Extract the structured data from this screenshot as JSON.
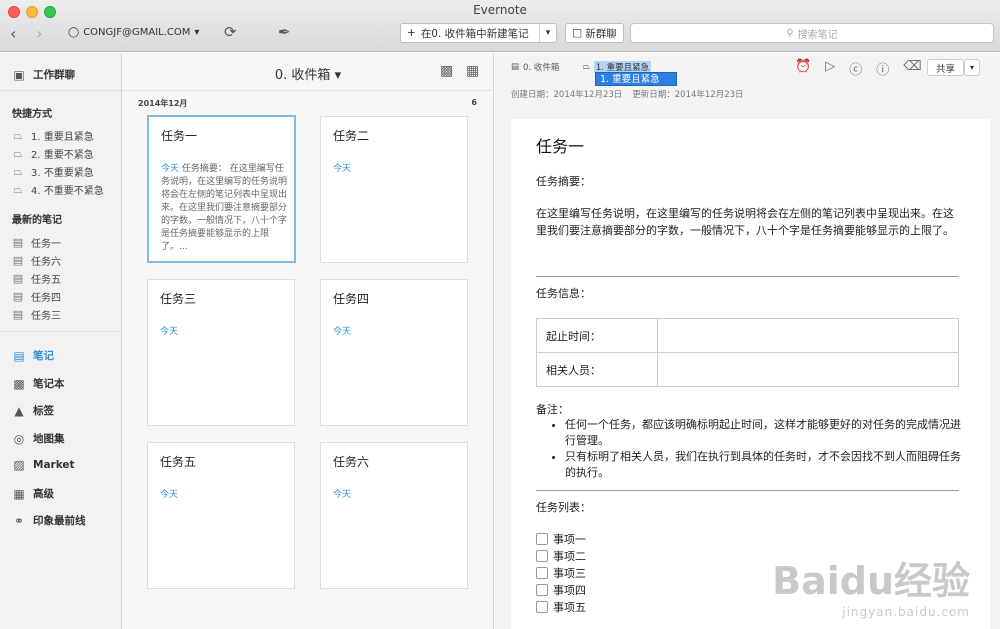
{
  "window": {
    "title": "Evernote"
  },
  "toolbar": {
    "account": "CONGJF@GMAIL.COM",
    "new_note_label": "在0. 收件箱中新建笔记",
    "chat_label": "新群聊",
    "search_placeholder": "搜索笔记"
  },
  "sidebar": {
    "work_chat": "工作群聊",
    "shortcuts_heading": "快捷方式",
    "shortcuts": [
      "1. 重要且紧急",
      "2. 重要不紧急",
      "3. 不重要紧急",
      "4. 不重要不紧急"
    ],
    "recent_heading": "最新的笔记",
    "recent": [
      "任务一",
      "任务六",
      "任务五",
      "任务四",
      "任务三"
    ],
    "nav": [
      "笔记",
      "笔记本",
      "标签",
      "地图集",
      "Market",
      "高级",
      "印象最前线"
    ]
  },
  "notelist": {
    "title": "0. 收件箱",
    "date_group": "2014年12月",
    "count": "6",
    "cards": [
      {
        "title": "任务一",
        "date": "今天",
        "snippet": "任务摘要： 在这里编写任务说明，在这里编写的任务说明将会在左侧的笔记列表中呈现出来。在这里我们要注意摘要部分的字数，一般情况下，八十个字是任务摘要能够显示的上限了。…"
      },
      {
        "title": "任务二",
        "date": "今天",
        "snippet": ""
      },
      {
        "title": "任务三",
        "date": "今天",
        "snippet": ""
      },
      {
        "title": "任务四",
        "date": "今天",
        "snippet": ""
      },
      {
        "title": "任务五",
        "date": "今天",
        "snippet": ""
      },
      {
        "title": "任务六",
        "date": "今天",
        "snippet": ""
      }
    ]
  },
  "editor": {
    "notebook": "0. 收件箱",
    "tag_selected": "1. 重要且紧急",
    "tag_suggestion": "1. 重要且紧急",
    "created": "创建日期：2014年12月23日",
    "updated": "更新日期：2014年12月23日",
    "share_label": "共享",
    "title": "任务一",
    "summary_label": "任务摘要：",
    "summary_text": "在这里编写任务说明，在这里编写的任务说明将会在左侧的笔记列表中呈现出来。在这里我们要注意摘要部分的字数，一般情况下，八十个字是任务摘要能够显示的上限了。",
    "info_label": "任务信息：",
    "table": [
      {
        "label": "起止时间：",
        "value": ""
      },
      {
        "label": "相关人员：",
        "value": ""
      }
    ],
    "notes_label": "备注：",
    "notes": [
      "任何一个任务，都应该明确标明起止时间，这样才能够更好的对任务的完成情况进行管理。",
      "只有标明了相关人员，我们在执行到具体的任务时，才不会因找不到人而阻碍任务的执行。"
    ],
    "tasks_label": "任务列表：",
    "tasks": [
      "事项一",
      "事项二",
      "事项三",
      "事项四",
      "事项五"
    ]
  },
  "watermark": {
    "line1": "Baidu经验",
    "line2": "jingyan.baidu.com"
  }
}
